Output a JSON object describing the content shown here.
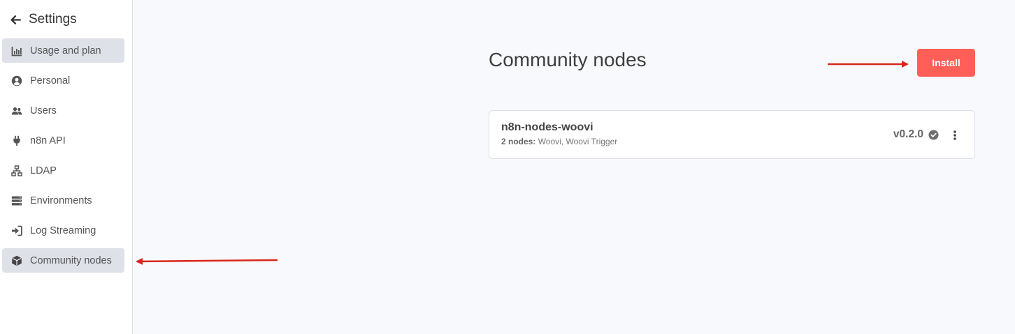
{
  "sidebar": {
    "title": "Settings",
    "items": [
      {
        "label": "Usage and plan",
        "icon": "usage-chart-icon"
      },
      {
        "label": "Personal",
        "icon": "user-circle-icon"
      },
      {
        "label": "Users",
        "icon": "users-icon"
      },
      {
        "label": "n8n API",
        "icon": "plug-icon"
      },
      {
        "label": "LDAP",
        "icon": "network-icon"
      },
      {
        "label": "Environments",
        "icon": "server-icon"
      },
      {
        "label": "Log Streaming",
        "icon": "sign-in-icon"
      },
      {
        "label": "Community nodes",
        "icon": "cube-icon"
      }
    ]
  },
  "main": {
    "title": "Community nodes",
    "install_label": "Install",
    "nodes": [
      {
        "name": "n8n-nodes-woovi",
        "count_label": "2 nodes:",
        "node_list": "Woovi, Woovi Trigger",
        "version": "v0.2.0"
      }
    ]
  },
  "colors": {
    "accent": "#ff5f56",
    "annotation_arrow": "#d9261c",
    "active_nav": "#dfe1e8"
  }
}
